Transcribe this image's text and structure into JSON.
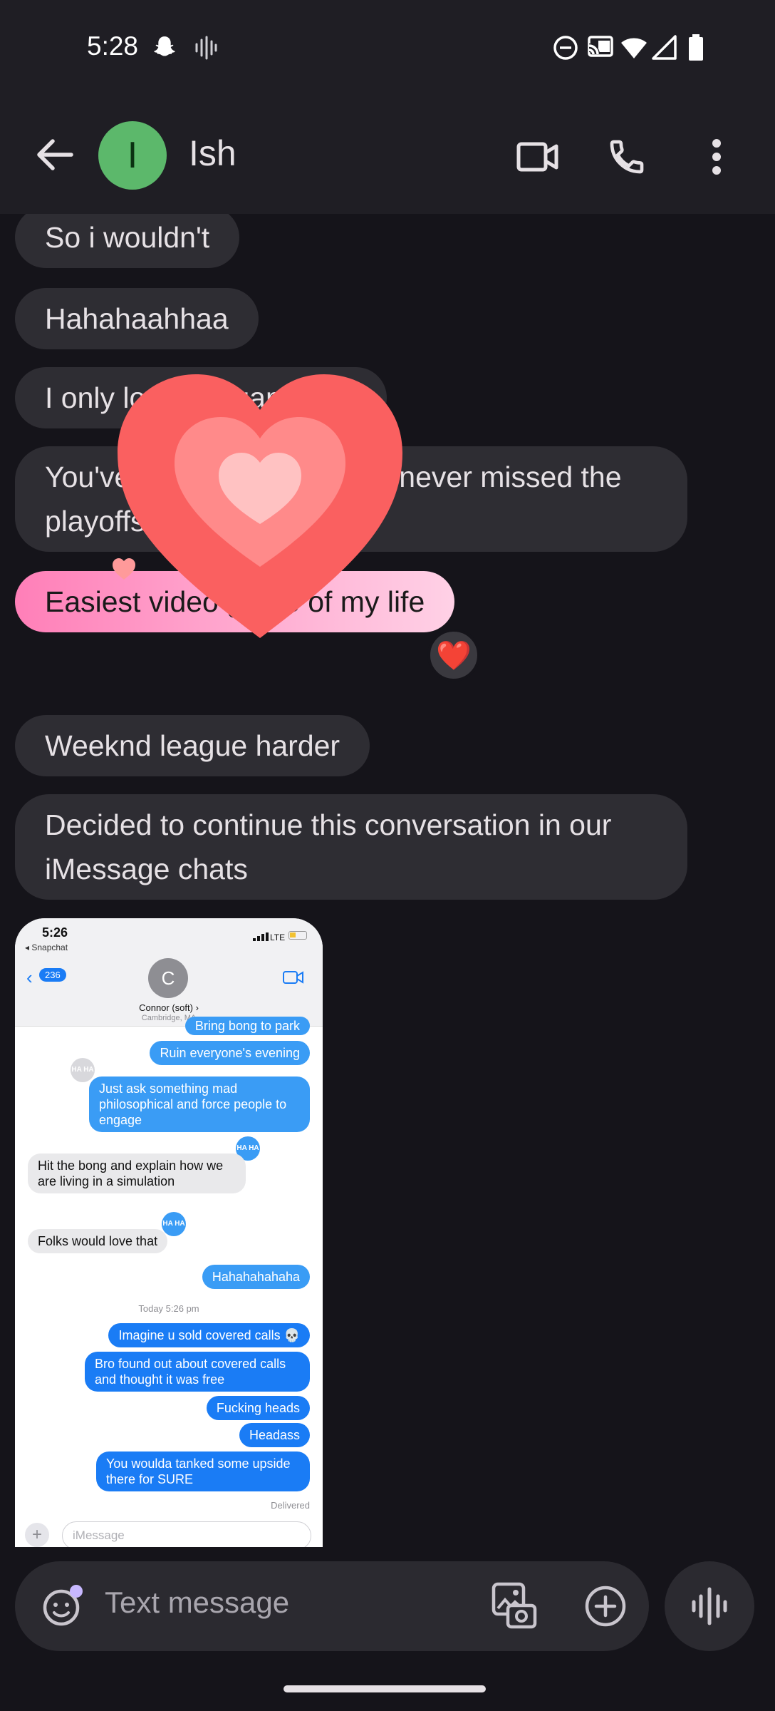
{
  "status": {
    "time": "5:28"
  },
  "appbar": {
    "avatar_letter": "I",
    "contact_name": "Ish"
  },
  "messages": [
    {
      "text": "So i wouldn't"
    },
    {
      "text": "Hahahaahhaa"
    },
    {
      "text": "I only lost one game bro"
    },
    {
      "text": "You've won for 2 years I've never missed the playoffs"
    },
    {
      "text": "Easiest video game of my life",
      "reaction": "❤️"
    },
    {
      "text": "Weeknd league harder"
    },
    {
      "text": "Decided to continue this conversation in our iMessage chats"
    }
  ],
  "screenshot": {
    "time": "5:26",
    "source_app": "◂ Snapchat",
    "network": "LTE",
    "back_count": "236",
    "contact_initial": "C",
    "contact_name": "Connor (soft) ›",
    "contact_location": "Cambridge, MA",
    "msgs": [
      "Bring bong to park",
      "Ruin everyone's evening",
      "Just ask something mad philosophical and force people to engage",
      "Hit the bong and explain how we are living in a simulation",
      "Folks would love that",
      "Hahahahahaha",
      "Imagine u sold covered calls 💀",
      "Bro found out about covered calls and thought it was free",
      "Fucking heads",
      "Headass",
      "You woulda tanked some upside there for SURE"
    ],
    "haha_label": "HA HA",
    "divider": "Today 5:26 pm",
    "delivered": "Delivered",
    "input_placeholder": "iMessage"
  },
  "compose": {
    "placeholder": "Text message"
  },
  "colors": {
    "accent_pink": "#ff7fb8",
    "avatar_green": "#5cb86b",
    "imessage_blue": "#1a7cf5"
  }
}
